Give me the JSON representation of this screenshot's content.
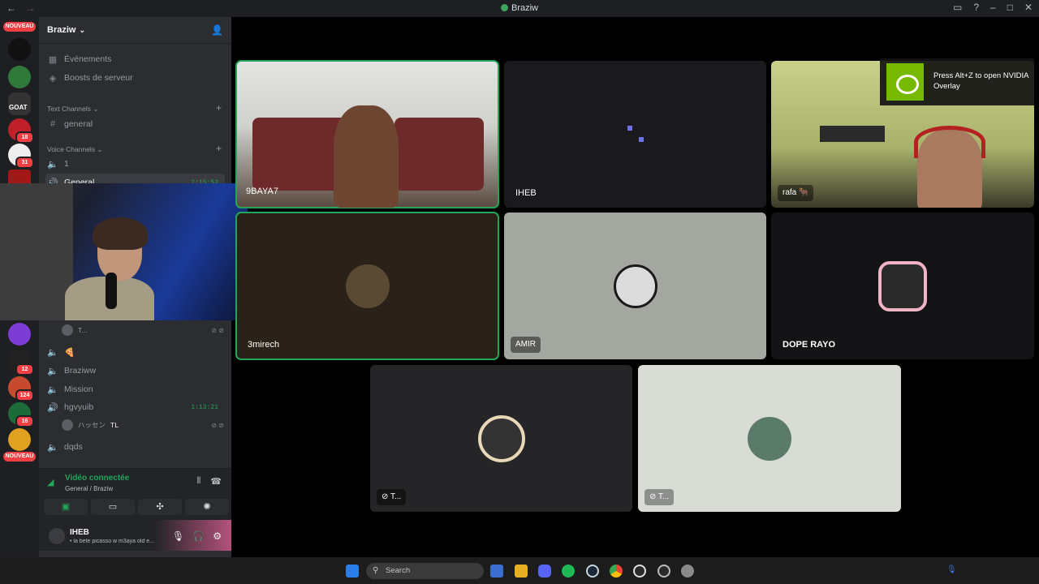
{
  "window": {
    "title": "Braziw",
    "nav_back": "←",
    "nav_forward": "→",
    "icons": [
      "inbox-icon",
      "help-icon",
      "minimize-icon",
      "maximize-icon",
      "close-icon"
    ]
  },
  "rail": {
    "new_top": "NOUVEAU",
    "new_bottom": "NOUVEAU",
    "badges": {
      "s4": "18",
      "s5": "31",
      "s8": "12",
      "s9": "124",
      "s10": "16"
    },
    "goat_text": "GOAT"
  },
  "sidebar": {
    "server_name": "Braziw",
    "events": "Événements",
    "boosts": "Boosts de serveur",
    "text_category": "Text Channels",
    "voice_category": "Voice Channels",
    "channels": {
      "general_text": "general",
      "voice_1": "1",
      "voice_general": "General",
      "voice_general_timer": "2:15:53",
      "voice_emoji": "🍕",
      "voice_braziww": "Braziww",
      "voice_mission": "Mission",
      "voice_hgvyuib": "hgvyuib",
      "voice_hgvyuib_timer": "1:13:21",
      "voice_dqds": "dqds"
    },
    "members": {
      "member_top": "T...",
      "member_hgv": "ハッセン",
      "member_hgv_tag": "TL"
    }
  },
  "voice_panel": {
    "status": "Vidéo connectée",
    "sub": "General / Braziw"
  },
  "user_panel": {
    "name": "IHEB",
    "status": "• la bete picasso w m3aya old e..."
  },
  "tiles": {
    "t1": "9BAYA7",
    "t2": "IHEB",
    "t3": "rafa 🐂",
    "t4": "3mirech",
    "t5": "AMIR",
    "t6": "DOPE RAYO",
    "t7": "T...",
    "t8": "T..."
  },
  "nvidia": {
    "text": "Press Alt+Z to open NVIDIA Overlay"
  },
  "taskbar": {
    "search_placeholder": "Search"
  },
  "colors": {
    "speaking": "#23a55a",
    "danger": "#f23f43",
    "nvidia": "#76b900"
  }
}
